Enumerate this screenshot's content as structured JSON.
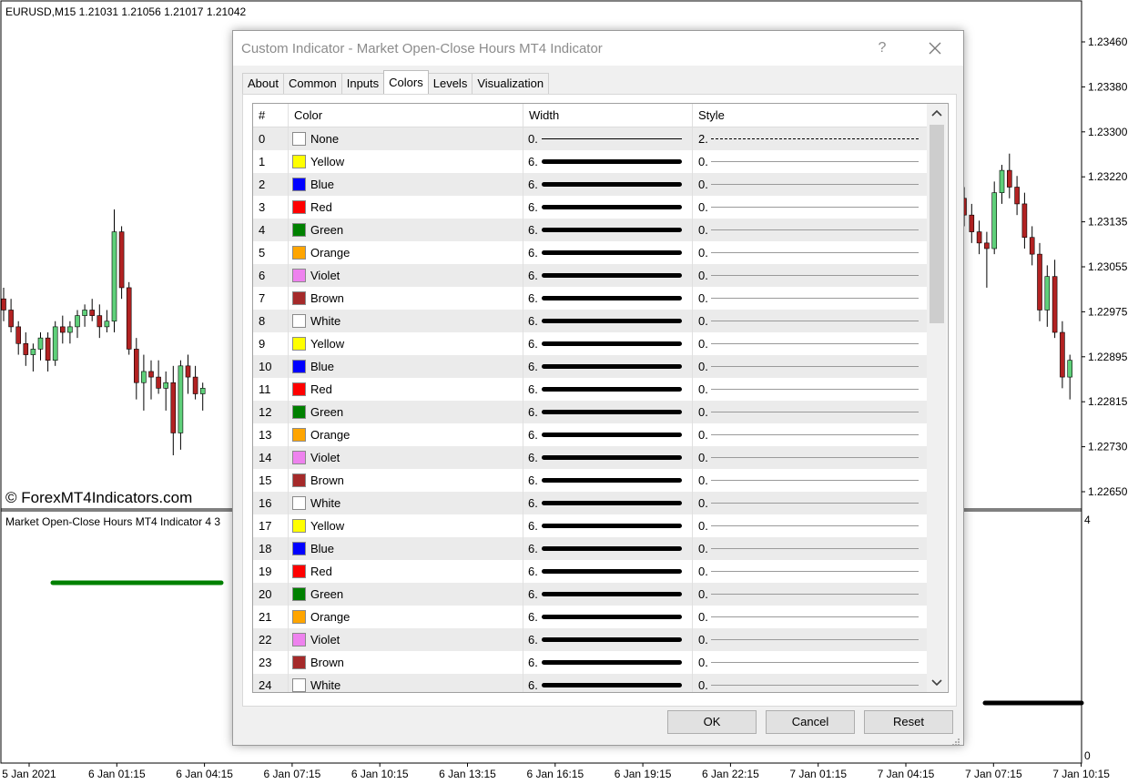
{
  "chart": {
    "symbol_info": "EURUSD,M15  1.21031 1.21056 1.21017 1.21042",
    "watermark": "© ForexMT4Indicators.com",
    "indicator_label": "Market Open-Close Hours MT4 Indicator 4 3",
    "price_axis": [
      "1.23460",
      "1.23380",
      "1.23300",
      "1.23220",
      "1.23135",
      "1.23055",
      "1.22975",
      "1.22895",
      "1.22815",
      "1.22730",
      "1.22650"
    ],
    "indicator_axis": [
      "4",
      "0"
    ],
    "time_axis": [
      "5 Jan 2021",
      "6 Jan 01:15",
      "6 Jan 04:15",
      "6 Jan 07:15",
      "6 Jan 10:15",
      "6 Jan 13:15",
      "6 Jan 16:15",
      "6 Jan 19:15",
      "6 Jan 22:15",
      "7 Jan 01:15",
      "7 Jan 04:15",
      "7 Jan 07:15",
      "7 Jan 10:15"
    ],
    "colors": {
      "bull": "#5fd07a",
      "bear": "#b22222",
      "green_line": "#008000",
      "black_line": "#000000"
    }
  },
  "dialog": {
    "title": "Custom Indicator - Market Open-Close Hours MT4 Indicator",
    "help": "?",
    "tabs": [
      "About",
      "Common",
      "Inputs",
      "Colors",
      "Levels",
      "Visualization"
    ],
    "active_tab": "Colors",
    "columns": {
      "num": "#",
      "color": "Color",
      "width": "Width",
      "style": "Style"
    },
    "rows": [
      {
        "num": "0",
        "color": "None",
        "hex": "#ffffff",
        "width": "0.",
        "style": "2."
      },
      {
        "num": "1",
        "color": "Yellow",
        "hex": "#ffff00",
        "width": "6.",
        "style": "0."
      },
      {
        "num": "2",
        "color": "Blue",
        "hex": "#0000ff",
        "width": "6.",
        "style": "0."
      },
      {
        "num": "3",
        "color": "Red",
        "hex": "#ff0000",
        "width": "6.",
        "style": "0."
      },
      {
        "num": "4",
        "color": "Green",
        "hex": "#008000",
        "width": "6.",
        "style": "0."
      },
      {
        "num": "5",
        "color": "Orange",
        "hex": "#ffa500",
        "width": "6.",
        "style": "0."
      },
      {
        "num": "6",
        "color": "Violet",
        "hex": "#ee82ee",
        "width": "6.",
        "style": "0."
      },
      {
        "num": "7",
        "color": "Brown",
        "hex": "#a52a2a",
        "width": "6.",
        "style": "0."
      },
      {
        "num": "8",
        "color": "White",
        "hex": "#ffffff",
        "width": "6.",
        "style": "0."
      },
      {
        "num": "9",
        "color": "Yellow",
        "hex": "#ffff00",
        "width": "6.",
        "style": "0."
      },
      {
        "num": "10",
        "color": "Blue",
        "hex": "#0000ff",
        "width": "6.",
        "style": "0."
      },
      {
        "num": "11",
        "color": "Red",
        "hex": "#ff0000",
        "width": "6.",
        "style": "0."
      },
      {
        "num": "12",
        "color": "Green",
        "hex": "#008000",
        "width": "6.",
        "style": "0."
      },
      {
        "num": "13",
        "color": "Orange",
        "hex": "#ffa500",
        "width": "6.",
        "style": "0."
      },
      {
        "num": "14",
        "color": "Violet",
        "hex": "#ee82ee",
        "width": "6.",
        "style": "0."
      },
      {
        "num": "15",
        "color": "Brown",
        "hex": "#a52a2a",
        "width": "6.",
        "style": "0."
      },
      {
        "num": "16",
        "color": "White",
        "hex": "#ffffff",
        "width": "6.",
        "style": "0."
      },
      {
        "num": "17",
        "color": "Yellow",
        "hex": "#ffff00",
        "width": "6.",
        "style": "0."
      },
      {
        "num": "18",
        "color": "Blue",
        "hex": "#0000ff",
        "width": "6.",
        "style": "0."
      },
      {
        "num": "19",
        "color": "Red",
        "hex": "#ff0000",
        "width": "6.",
        "style": "0."
      },
      {
        "num": "20",
        "color": "Green",
        "hex": "#008000",
        "width": "6.",
        "style": "0."
      },
      {
        "num": "21",
        "color": "Orange",
        "hex": "#ffa500",
        "width": "6.",
        "style": "0."
      },
      {
        "num": "22",
        "color": "Violet",
        "hex": "#ee82ee",
        "width": "6.",
        "style": "0."
      },
      {
        "num": "23",
        "color": "Brown",
        "hex": "#a52a2a",
        "width": "6.",
        "style": "0."
      },
      {
        "num": "24",
        "color": "White",
        "hex": "#ffffff",
        "width": "6.",
        "style": "0."
      }
    ],
    "buttons": {
      "ok": "OK",
      "cancel": "Cancel",
      "reset": "Reset"
    }
  }
}
